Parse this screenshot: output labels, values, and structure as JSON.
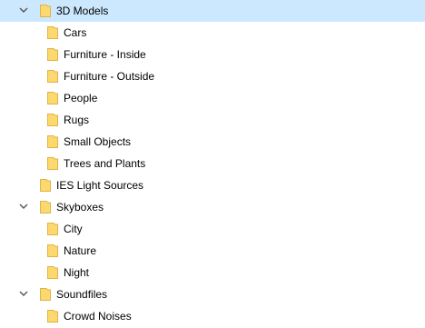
{
  "colors": {
    "selection": "#cce8ff",
    "folder_fill": "#fbd96e",
    "folder_edge": "#e1b347",
    "chevron": "#555555"
  },
  "icons": {
    "expanded": "chevron-down-icon",
    "folder": "folder-icon"
  },
  "tree": {
    "items": [
      {
        "label": "3D Models",
        "expanded": true,
        "selected": true
      },
      {
        "label": "Cars"
      },
      {
        "label": "Furniture - Inside"
      },
      {
        "label": "Furniture - Outside"
      },
      {
        "label": "People"
      },
      {
        "label": "Rugs"
      },
      {
        "label": "Small Objects"
      },
      {
        "label": "Trees and Plants"
      },
      {
        "label": "IES Light Sources"
      },
      {
        "label": "Skyboxes",
        "expanded": true
      },
      {
        "label": "City"
      },
      {
        "label": "Nature"
      },
      {
        "label": "Night"
      },
      {
        "label": "Soundfiles",
        "expanded": true
      },
      {
        "label": "Crowd Noises"
      }
    ]
  }
}
